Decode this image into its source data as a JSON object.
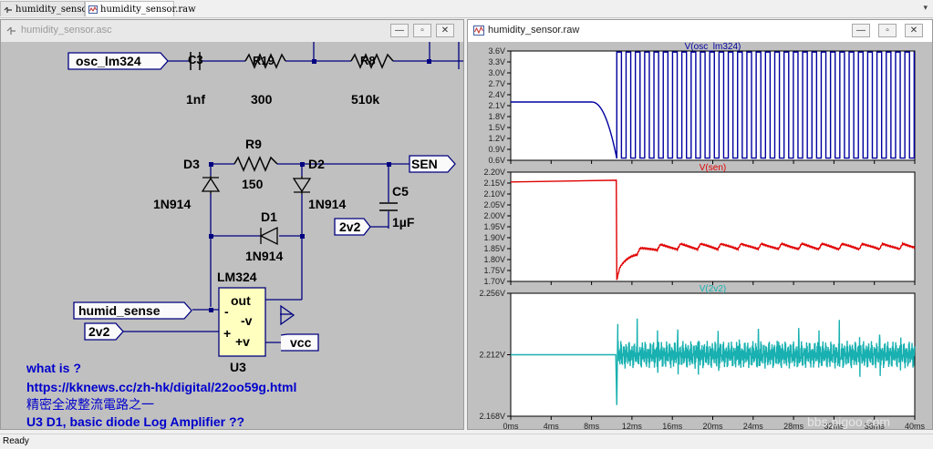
{
  "tabs": [
    {
      "label": "humidity_sensor.asc"
    },
    {
      "label": "humidity_sensor.raw"
    }
  ],
  "status": "Ready",
  "schematic": {
    "title": "humidity_sensor.asc",
    "components": {
      "c3_ref": "C3",
      "c3_val": "1nf",
      "r19_ref": "R19",
      "r19_val": "300",
      "r8_ref": "R8",
      "r8_val": "510k",
      "r9_ref": "R9",
      "r9_val": "150",
      "d3_ref": "D3",
      "d3_val": "1N914",
      "d2_ref": "D2",
      "d2_val": "1N914",
      "d1_ref": "D1",
      "d1_val": "1N914",
      "c5_ref": "C5",
      "c5_val": "1µF",
      "u3_type": "LM324",
      "u3_ref": "U3",
      "pin_out": "out",
      "pin_minus": "-",
      "pin_nv": "-v",
      "pin_plus": "+",
      "pin_pv": "+v"
    },
    "labels": {
      "osc": "osc_lm324",
      "sen": "SEN",
      "v2v2_c5": "2v2",
      "humid": "humid_sense",
      "v2v2": "2v2",
      "vcc": "vcc"
    },
    "comments": [
      "what is ?",
      "https://kknews.cc/zh-hk/digital/22oo59g.html",
      "精密全波整流電路之一",
      "U3 D1, basic diode Log Amplifier ??"
    ]
  },
  "waveform": {
    "title": "humidity_sensor.raw",
    "watermark": "bbs.pigoo.com",
    "x_ticks": [
      "0ms",
      "4ms",
      "8ms",
      "12ms",
      "16ms",
      "20ms",
      "24ms",
      "28ms",
      "32ms",
      "36ms",
      "40ms"
    ]
  },
  "colors": {
    "osc": "#0000a0",
    "sen": "#e00000",
    "v2v2": "#18b0b0",
    "comment": "#0000cc",
    "wire": "#000080",
    "net_label_bg": "#fafafa",
    "opamp": "#ffffc0"
  },
  "chart_data": [
    {
      "type": "line",
      "title": "V(osc_lm324)",
      "xlim": [
        0,
        40
      ],
      "ylim": [
        0.6,
        3.6
      ],
      "y_ticks": [
        "3.6V",
        "3.3V",
        "3.0V",
        "2.7V",
        "2.4V",
        "2.1V",
        "1.8V",
        "1.5V",
        "1.2V",
        "0.9V",
        "0.6V"
      ],
      "series": [
        {
          "name": "V(osc_lm324)",
          "shape": "flat ~2.2V then decays near 9ms, then square wave 0.66V–3.57V, period ~0.9ms, starting ~10.5ms",
          "x_start": 10.5,
          "period": 0.92,
          "low": 0.66,
          "high": 3.57,
          "initial": 2.2
        }
      ]
    },
    {
      "type": "line",
      "title": "V(sen)",
      "xlim": [
        0,
        40
      ],
      "ylim": [
        1.7,
        2.2
      ],
      "y_ticks": [
        "2.20V",
        "2.15V",
        "2.10V",
        "2.05V",
        "2.00V",
        "1.95V",
        "1.90V",
        "1.85V",
        "1.80V",
        "1.75V",
        "1.70V"
      ],
      "series": [
        {
          "name": "V(sen)",
          "points": [
            [
              0,
              2.155
            ],
            [
              10.4,
              2.163
            ],
            [
              10.5,
              1.72
            ],
            [
              11,
              1.76
            ],
            [
              13,
              1.83
            ],
            [
              16,
              1.855
            ],
            [
              20,
              1.86
            ],
            [
              30,
              1.865
            ],
            [
              40,
              1.87
            ]
          ],
          "ripple_period": 2.0,
          "ripple_amp": 0.025
        }
      ]
    },
    {
      "type": "line",
      "title": "V(2v2)",
      "xlim": [
        0,
        40
      ],
      "ylim": [
        2.168,
        2.256
      ],
      "y_ticks": [
        "2.256V",
        "2.212V",
        "2.168V"
      ],
      "series": [
        {
          "name": "V(2v2)",
          "baseline": 2.212,
          "spike_start": 10.5,
          "spike_period": 2.0,
          "spike_amp": 0.02,
          "noise_amp": 0.006,
          "first_dip": 2.176
        }
      ]
    }
  ]
}
